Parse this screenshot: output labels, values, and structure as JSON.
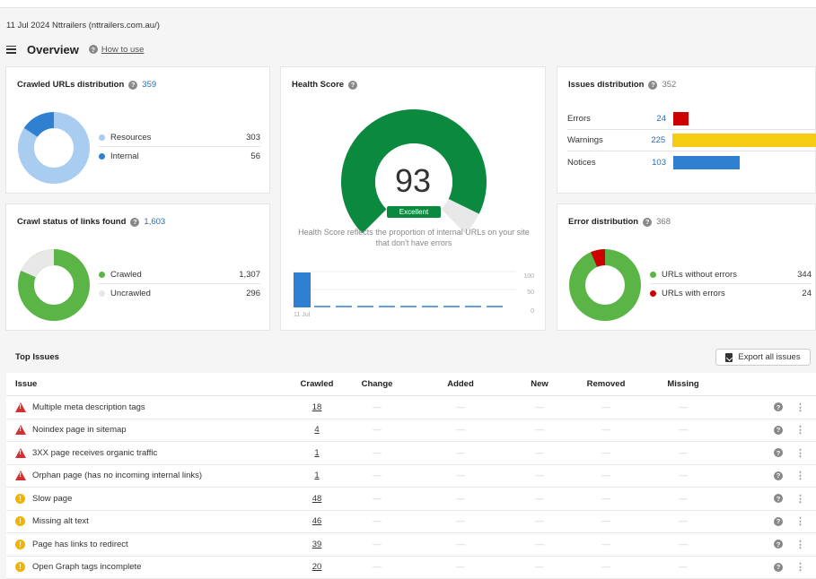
{
  "header": {
    "crawl_date": "11 Jul 2024 Nttrailers (nttrailers.com.au/)",
    "title": "Overview",
    "how_to_use": "How to use",
    "help_glyph": "?"
  },
  "crawled_urls": {
    "title": "Crawled URLs distribution",
    "total": "359",
    "items": [
      {
        "label": "Resources",
        "value": "303",
        "color": "#a9cdf0"
      },
      {
        "label": "Internal",
        "value": "56",
        "color": "#2f80d0"
      }
    ]
  },
  "crawl_status": {
    "title": "Crawl status of links found",
    "total": "1,603",
    "items": [
      {
        "label": "Crawled",
        "value": "1,307",
        "color": "#5bb546"
      },
      {
        "label": "Uncrawled",
        "value": "296",
        "color": "#e8e8e8"
      }
    ]
  },
  "health": {
    "title": "Health Score",
    "score": "93",
    "score_value": 93,
    "badge": "Excellent",
    "description": "Health Score reflects the proportion of internal URLs on your site that don't have errors",
    "y_ticks": [
      "100",
      "50",
      "0"
    ],
    "x_label": "11 Jul",
    "color": "#0b8a3f"
  },
  "issues_distribution": {
    "title": "Issues distribution",
    "total": "352",
    "items": [
      {
        "label": "Errors",
        "value": "24",
        "count": 24,
        "color": "#cc0000"
      },
      {
        "label": "Warnings",
        "value": "225",
        "count": 225,
        "color": "#f6cc12"
      },
      {
        "label": "Notices",
        "value": "103",
        "count": 103,
        "color": "#2f80d0"
      }
    ]
  },
  "error_distribution": {
    "title": "Error distribution",
    "total": "368",
    "items": [
      {
        "label": "URLs without errors",
        "value": "344",
        "color": "#5bb546"
      },
      {
        "label": "URLs with errors",
        "value": "24",
        "color": "#cc0000"
      }
    ]
  },
  "top_issues": {
    "title": "Top Issues",
    "export_label": "Export all issues",
    "columns": [
      "Issue",
      "Crawled",
      "Change",
      "Added",
      "New",
      "Removed",
      "Missing"
    ],
    "dash": "—",
    "kebab": "⋮",
    "rows": [
      {
        "issue": "Multiple meta description tags",
        "crawled": "18",
        "severity": "error"
      },
      {
        "issue": "Noindex page in sitemap",
        "crawled": "4",
        "severity": "error"
      },
      {
        "issue": "3XX page receives organic traffic",
        "crawled": "1",
        "severity": "error"
      },
      {
        "issue": "Orphan page (has no incoming internal links)",
        "crawled": "1",
        "severity": "error"
      },
      {
        "issue": "Slow page",
        "crawled": "48",
        "severity": "warning"
      },
      {
        "issue": "Missing alt text",
        "crawled": "46",
        "severity": "warning"
      },
      {
        "issue": "Page has links to redirect",
        "crawled": "39",
        "severity": "warning"
      },
      {
        "issue": "Open Graph tags incomplete",
        "crawled": "20",
        "severity": "warning"
      }
    ]
  }
}
